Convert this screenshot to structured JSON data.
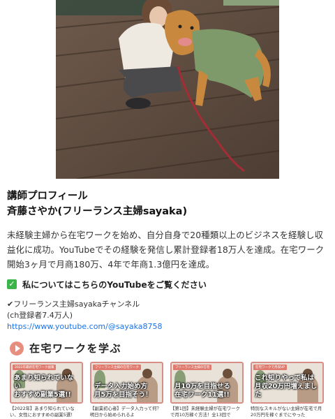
{
  "photo": {
    "description_icon": "photo-woman-with-golden-retriever"
  },
  "profile": {
    "heading": "講師プロフィール",
    "name": "斉藤さやか(フリーランス主婦sayaka)",
    "bio": "未経験主婦から在宅ワークを始め、自分自身で20種類以上のビジネスを経験し収益化に成功。YouTubeでその経験を発信し累計登録者18万人を達成。在宅ワーク開始3ヶ月で月商180万、4年で年商1.3億円を達成。",
    "youtube_prompt": "私についてはこちらのYouTubeをご覧ください",
    "channel_name": "✔フリーランス主婦sayakaチャンネル",
    "subscribers": "(ch登録者7.4万人)",
    "channel_url": "https://www.youtube.com/@sayaka8758"
  },
  "learn": {
    "title": "在宅ワークを学ぶ",
    "cards": [
      {
        "tag": "2022年最新在宅ワーク副業",
        "caption_1": "あまり知られていない",
        "caption_2": "おすすめ副業5選!!",
        "desc": "【2022年】あまり知られていない、女性におすすめの副業5選！"
      },
      {
        "tag": "フリーランス主婦の在宅ワーク",
        "caption_1": "データ入力始め方",
        "caption_2": "月5万を目指そう！",
        "desc": "【副業初心者】データ入力って何？明日から始められるよ"
      },
      {
        "tag": "フリーランス主婦の在宅",
        "caption_1": "月10万を目指せる",
        "caption_2": "在宅ワーク11選!!",
        "desc": "【第1回】未経験主婦が在宅ワークで月10万稼ぐ方法！全13回で"
      },
      {
        "tag": "在宅ワークで月収UP",
        "caption_1": "これ知りやって私は",
        "caption_2": "月収20万円増えました",
        "desc": "特別なスキルがない主婦が在宅で月20万円を稼ぐまでにやった"
      }
    ]
  },
  "colors": {
    "accent": "#e88e7f",
    "link": "#1a73e8",
    "check": "#3bb54a"
  }
}
